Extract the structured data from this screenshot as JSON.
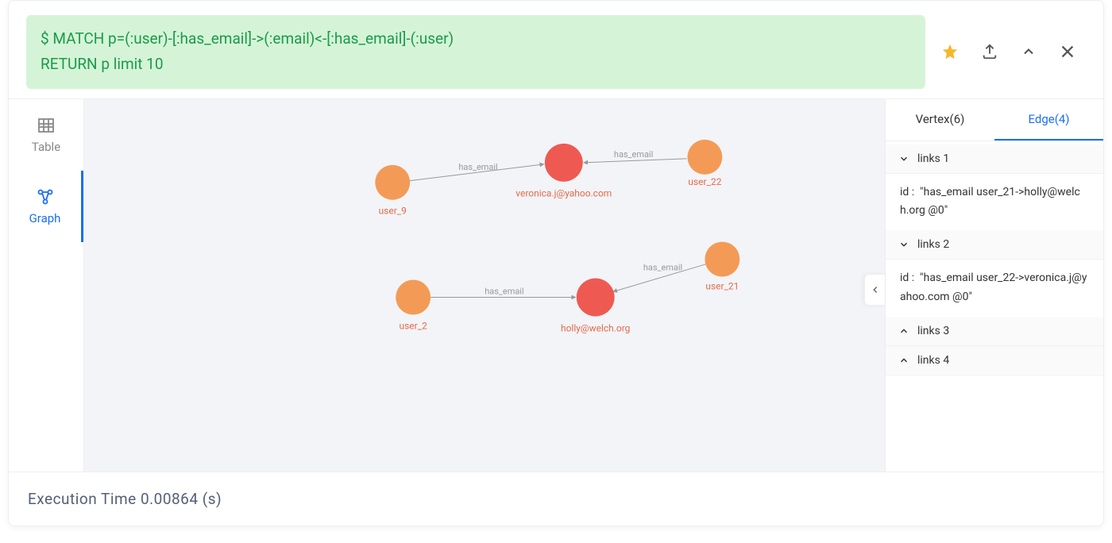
{
  "query": {
    "line1": "$ MATCH p=(:user)-[:has_email]->(:email)<-[:has_email]-(:user)",
    "line2": "RETURN p limit 10"
  },
  "view_tabs": {
    "table": "Table",
    "graph": "Graph"
  },
  "side_tabs": {
    "vertex": "Vertex(6)",
    "edge": "Edge(4)"
  },
  "nodes": {
    "user_9": "user_9",
    "veronica": "veronica.j@yahoo.com",
    "user_22": "user_22",
    "user_2": "user_2",
    "holly": "holly@welch.org",
    "user_21": "user_21"
  },
  "edge_label": "has_email",
  "links": {
    "l1": {
      "title": "links 1",
      "id_label": "id :",
      "id_value": "\"has_email user_21->holly@welch.org @0\""
    },
    "l2": {
      "title": "links 2",
      "id_label": "id :",
      "id_value": "\"has_email user_22->veronica.j@yahoo.com @0\""
    },
    "l3": {
      "title": "links 3"
    },
    "l4": {
      "title": "links 4"
    }
  },
  "footer": "Execution Time 0.00864 (s)",
  "colors": {
    "user_node": "#f39b56",
    "email_node": "#ee5a52",
    "edge": "#999"
  }
}
